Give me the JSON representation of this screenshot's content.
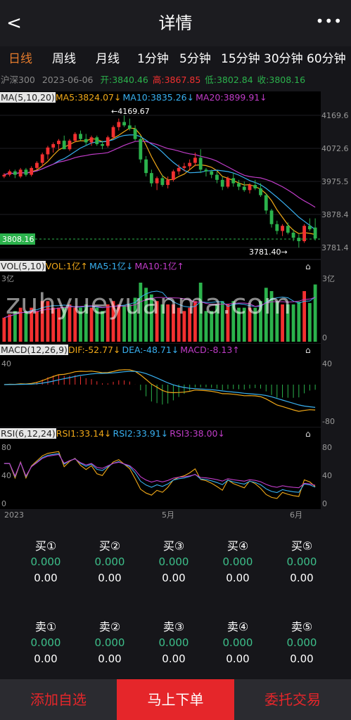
{
  "header": {
    "back": "<",
    "title": "详情",
    "more": "•••"
  },
  "tabs": [
    {
      "label": "日线",
      "active": true
    },
    {
      "label": "周线"
    },
    {
      "label": "月线"
    },
    {
      "label": "1分钟"
    },
    {
      "label": "5分钟"
    },
    {
      "label": "15分钟"
    },
    {
      "label": "30分钟"
    },
    {
      "label": "60分钟"
    }
  ],
  "info": {
    "name": "沪深300",
    "date": "2023-06-06",
    "open": "开:3840.46",
    "high": "高:3867.85",
    "low": "低:3802.84",
    "close": "收:3808.16"
  },
  "main_chart": {
    "legend": {
      "tag": "MA(5,10,20)",
      "ma5": "MA5:3824.07↓",
      "ma10": "MA10:3835.26↓",
      "ma20": "MA20:3899.91↓"
    },
    "axis_labels": [
      "4169.6",
      "4072.6",
      "3975.5",
      "3878.4",
      "3781.4"
    ],
    "high_label": "←4169.67",
    "low_label": "3781.40→",
    "last_price": "3808.16"
  },
  "vol_chart": {
    "legend": {
      "tag": "VOL(5,10)",
      "vol": "VOL:1亿↑",
      "ma5": "MA5:1亿↓",
      "ma10": "MA10:1亿↑"
    },
    "left_top": "3亿",
    "right_top": "3亿",
    "right_bottom": "0"
  },
  "macd_chart": {
    "legend": {
      "tag": "MACD(12,26,9)",
      "dif": "DIF:-52.77↓",
      "dea": "DEA:-48.71↓",
      "macd": "MACD:-8.13↑"
    },
    "left_top": "40",
    "right_top": "40",
    "right_bottom": "-80"
  },
  "rsi_chart": {
    "legend": {
      "tag": "RSI(6,12,24)",
      "rsi1": "RSI1:33.14↓",
      "rsi2": "RSI2:33.91↓",
      "rsi3": "RSI3:38.00↓"
    },
    "left_80": "80",
    "left_40": "40",
    "left_0": "0",
    "right_80": "80",
    "right_40": "40",
    "right_0": "0"
  },
  "x_axis": [
    "2023",
    "5月",
    "6月"
  ],
  "buy": [
    {
      "label": "买①",
      "v1": "0.000",
      "v2": "0.00"
    },
    {
      "label": "买②",
      "v1": "0.000",
      "v2": "0.00"
    },
    {
      "label": "买③",
      "v1": "0.000",
      "v2": "0.00"
    },
    {
      "label": "买④",
      "v1": "0.000",
      "v2": "0.00"
    },
    {
      "label": "买⑤",
      "v1": "0.000",
      "v2": "0.00"
    }
  ],
  "sell": [
    {
      "label": "卖①",
      "v1": "0.000",
      "v2": "0.00"
    },
    {
      "label": "卖②",
      "v1": "0.000",
      "v2": "0.00"
    },
    {
      "label": "卖③",
      "v1": "0.000",
      "v2": "0.00"
    },
    {
      "label": "卖④",
      "v1": "0.000",
      "v2": "0.00"
    },
    {
      "label": "卖⑤",
      "v1": "0.000",
      "v2": "0.00"
    }
  ],
  "footer": {
    "add": "添加自选",
    "order": "马上下单",
    "entrust": "委托交易"
  },
  "watermark": "zuhyueyuanma.com",
  "colors": {
    "up": "#f23030",
    "down": "#2bb24c",
    "ma5": "#f0a818",
    "ma10": "#38b0f0",
    "ma20": "#c03cc8",
    "accent": "#e57b2c",
    "footer_red": "#e5262a"
  },
  "chart_data": {
    "type": "candlestick",
    "series": [
      {
        "name": "K线",
        "ohlc": [
          [
            3990,
            4000,
            3985,
            3995
          ],
          [
            3995,
            4010,
            3990,
            4005
          ],
          [
            4005,
            4010,
            3985,
            3995
          ],
          [
            3990,
            4015,
            3985,
            4010
          ],
          [
            4010,
            4015,
            3990,
            3995
          ],
          [
            3995,
            4020,
            3990,
            4015
          ],
          [
            4015,
            4035,
            4010,
            4030
          ],
          [
            4030,
            4060,
            4020,
            4055
          ],
          [
            4055,
            4080,
            4040,
            4075
          ],
          [
            4075,
            4090,
            4060,
            4085
          ],
          [
            4085,
            4100,
            4070,
            4095
          ],
          [
            4095,
            4110,
            4080,
            4070
          ],
          [
            4070,
            4100,
            4065,
            4095
          ],
          [
            4095,
            4120,
            4090,
            4115
          ],
          [
            4115,
            4125,
            4095,
            4100
          ],
          [
            4100,
            4115,
            4080,
            4090
          ],
          [
            4090,
            4110,
            4080,
            4105
          ],
          [
            4105,
            4110,
            4080,
            4085
          ],
          [
            4085,
            4095,
            4070,
            4080
          ],
          [
            4080,
            4110,
            4075,
            4105
          ],
          [
            4105,
            4140,
            4100,
            4135
          ],
          [
            4135,
            4160,
            4125,
            4150
          ],
          [
            4150,
            4169,
            4135,
            4140
          ],
          [
            4140,
            4160,
            4125,
            4130
          ],
          [
            4130,
            4140,
            4095,
            4100
          ],
          [
            4100,
            4110,
            4030,
            4040
          ],
          [
            4040,
            4050,
            3990,
            4000
          ],
          [
            4000,
            4010,
            3960,
            3970
          ],
          [
            3970,
            3990,
            3950,
            3985
          ],
          [
            3985,
            3995,
            3960,
            3965
          ],
          [
            3965,
            3990,
            3955,
            3980
          ],
          [
            3980,
            4010,
            3975,
            4005
          ],
          [
            4005,
            4025,
            3995,
            4015
          ],
          [
            4015,
            4030,
            4005,
            4020
          ],
          [
            4020,
            4040,
            4010,
            4030
          ],
          [
            4030,
            4060,
            4020,
            4045
          ],
          [
            4045,
            4070,
            4000,
            4010
          ],
          [
            4010,
            4015,
            3990,
            4005
          ],
          [
            4005,
            4010,
            3985,
            3995
          ],
          [
            3995,
            4005,
            3970,
            3980
          ],
          [
            3980,
            3990,
            3950,
            3960
          ],
          [
            3960,
            3990,
            3955,
            3985
          ],
          [
            3985,
            4000,
            3960,
            3970
          ],
          [
            3970,
            3980,
            3950,
            3960
          ],
          [
            3960,
            3975,
            3945,
            3950
          ],
          [
            3950,
            3970,
            3940,
            3965
          ],
          [
            3965,
            3980,
            3950,
            3955
          ],
          [
            3955,
            3970,
            3930,
            3935
          ],
          [
            3935,
            3940,
            3880,
            3890
          ],
          [
            3890,
            3895,
            3840,
            3850
          ],
          [
            3850,
            3860,
            3820,
            3830
          ],
          [
            3830,
            3850,
            3815,
            3845
          ],
          [
            3845,
            3855,
            3820,
            3825
          ],
          [
            3825,
            3835,
            3800,
            3810
          ],
          [
            3810,
            3820,
            3781,
            3800
          ],
          [
            3800,
            3850,
            3795,
            3845
          ],
          [
            3845,
            3867,
            3830,
            3835
          ],
          [
            3840,
            3867,
            3802,
            3808
          ]
        ]
      }
    ],
    "ylim": [
      3781.4,
      4169.6
    ],
    "x_labels": [
      "2023",
      "5月",
      "6月"
    ]
  }
}
